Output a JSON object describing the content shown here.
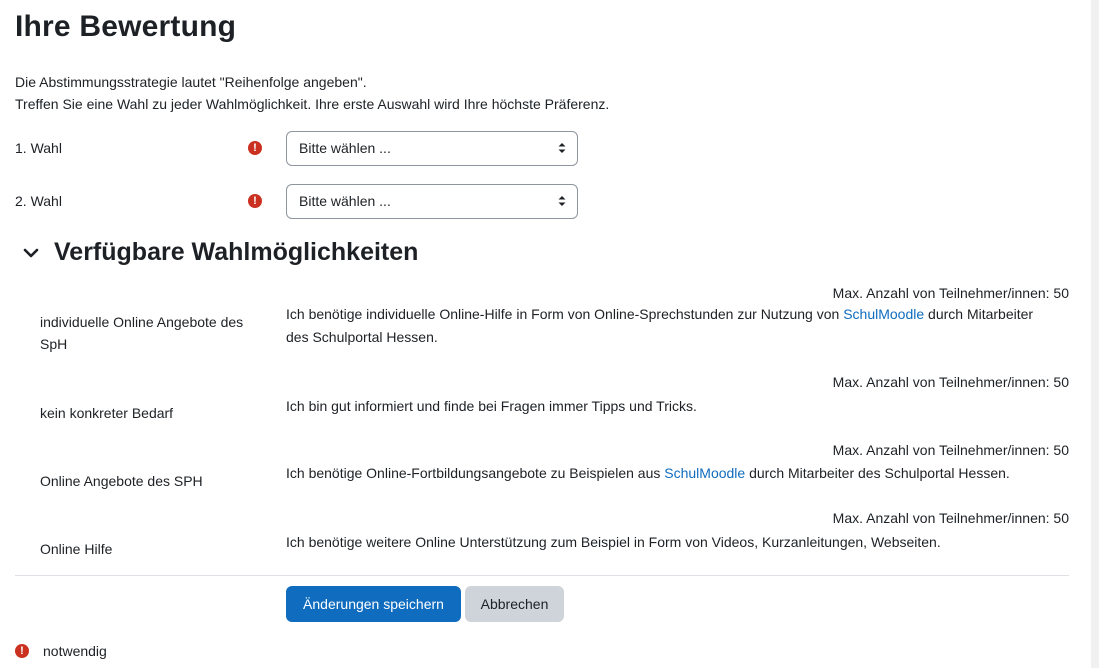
{
  "page": {
    "title": "Ihre Bewertung"
  },
  "intro": {
    "line1": "Die Abstimmungsstrategie lautet \"Reihenfolge angeben\".",
    "line2": "Treffen Sie eine Wahl zu jeder Wahlmöglichkeit. Ihre erste Auswahl wird Ihre höchste Präferenz."
  },
  "choices": [
    {
      "label": "1. Wahl",
      "placeholder": "Bitte wählen ..."
    },
    {
      "label": "2. Wahl",
      "placeholder": "Bitte wählen ..."
    }
  ],
  "options_section": {
    "title": "Verfügbare Wahlmöglichkeiten",
    "items": [
      {
        "name": "individuelle Online Angebote des SpH",
        "max": "Max. Anzahl von Teilnehmer/innen: 50",
        "desc_before": "Ich benötige individuelle Online-Hilfe in Form von Online-Sprechstunden zur Nutzung von ",
        "desc_link": "SchulMoodle",
        "desc_after": " durch Mitarbeiter des Schulportal Hessen."
      },
      {
        "name": "kein konkreter Bedarf",
        "max": "Max. Anzahl von Teilnehmer/innen: 50",
        "desc": "Ich bin gut informiert und finde bei Fragen immer Tipps und Tricks."
      },
      {
        "name": "Online Angebote des SPH",
        "max": "Max. Anzahl von Teilnehmer/innen: 50",
        "desc_before": "Ich benötige Online-Fortbildungsangebote zu Beispielen aus ",
        "desc_link": "SchulMoodle",
        "desc_after": " durch Mitarbeiter des Schulportal Hessen."
      },
      {
        "name": "Online Hilfe",
        "max": "Max. Anzahl von Teilnehmer/innen: 50",
        "desc": "Ich benötige weitere Online Unterstützung zum Beispiel in Form von Videos, Kurzanleitungen, Webseiten."
      }
    ]
  },
  "buttons": {
    "save": "Änderungen speichern",
    "cancel": "Abbrechen"
  },
  "footer": {
    "required_note": "notwendig"
  },
  "colors": {
    "primary": "#0f6cbf",
    "danger": "#ca3120",
    "secondary": "#ced4da",
    "text": "#1d2125"
  },
  "icons": {
    "required": "exclamation-circle-icon",
    "collapse": "chevron-down-icon",
    "select": "sort-caret-icon"
  }
}
